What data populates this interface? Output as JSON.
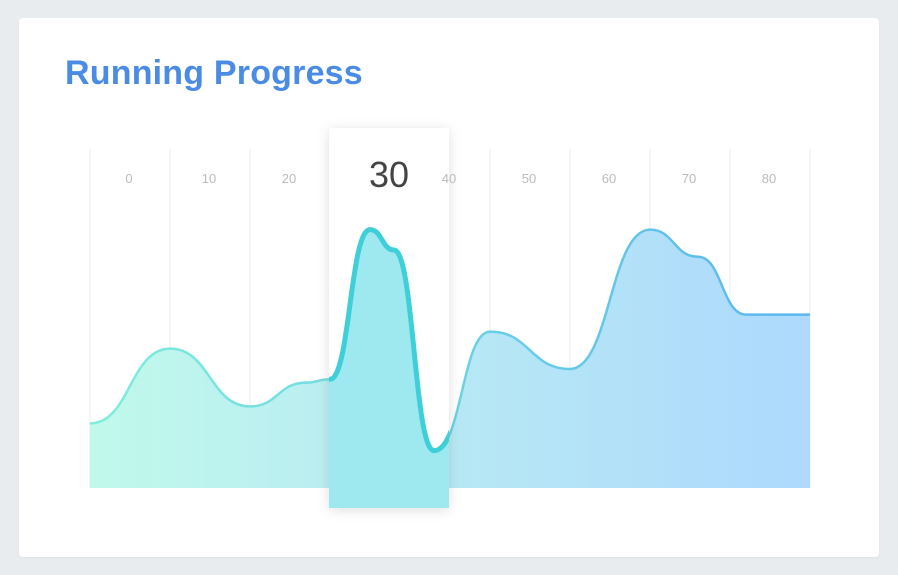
{
  "card": {
    "title": "Running Progress"
  },
  "colors": {
    "title": "#4a8be6",
    "gradient_start": "#bdf8ea",
    "gradient_end": "#a9d7fd",
    "line_start": "#7eeedc",
    "line_end": "#5bb6ef",
    "active_line": "#3ecfd8",
    "active_fill": "#9ee9f0",
    "grid": "#eeeeee"
  },
  "chart_data": {
    "type": "area",
    "title": "Running Progress",
    "xlabel": "",
    "ylabel": "",
    "x_ticks": [
      0,
      10,
      20,
      30,
      40,
      50,
      60,
      70,
      80
    ],
    "xlim": [
      0,
      90
    ],
    "ylim": [
      0,
      100
    ],
    "grid": true,
    "highlighted_tick": 30,
    "series": [
      {
        "x": [
          0,
          10,
          20,
          27,
          30,
          35,
          38,
          43,
          50,
          60,
          70,
          76,
          82,
          90
        ],
        "values": [
          19,
          41,
          24,
          31,
          32,
          76,
          70,
          11,
          46,
          35,
          76,
          68,
          51,
          51
        ]
      }
    ]
  }
}
